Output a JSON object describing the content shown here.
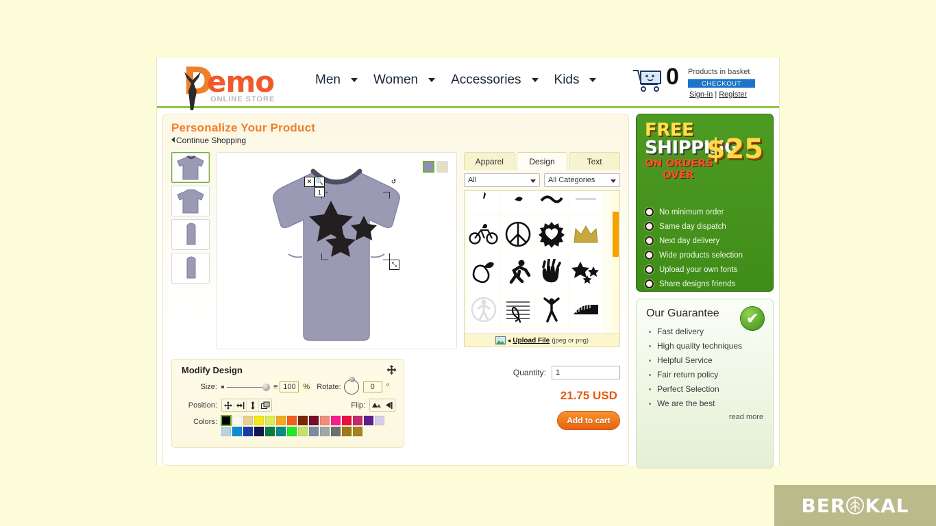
{
  "header": {
    "logo_main": "emo",
    "logo_d": "D",
    "logo_sub": "ONLINE STORE",
    "nav": [
      {
        "label": "Men"
      },
      {
        "label": "Women"
      },
      {
        "label": "Accessories"
      },
      {
        "label": "Kids"
      }
    ],
    "cart": {
      "count": "0",
      "text": "Products in basket",
      "checkout_label": "CHECKOUT",
      "signin": "Sign-in",
      "separator": "|",
      "register": "Register"
    }
  },
  "main": {
    "page_title": "Personalize Your Product",
    "continue_shopping": "Continue Shopping"
  },
  "stage": {
    "thumbnails": [
      {
        "name": "front-view"
      },
      {
        "name": "back-view"
      },
      {
        "name": "left-view"
      },
      {
        "name": "right-view"
      }
    ],
    "apparel_colors": [
      {
        "hex": "#8f8fbe",
        "selected": true
      },
      {
        "hex": "#e8ddc0",
        "selected": false
      }
    ],
    "design_layer_number": "1",
    "shirt_color": "#9a9ab4"
  },
  "tools": {
    "tabs": [
      {
        "label": "Apparel",
        "active": false
      },
      {
        "label": "Design",
        "active": true
      },
      {
        "label": "Text",
        "active": false
      }
    ],
    "filter_type": "All",
    "filter_category": "All Categories",
    "icons": [
      {
        "name": "partial-icon-1"
      },
      {
        "name": "partial-icon-2"
      },
      {
        "name": "partial-icon-3"
      },
      {
        "name": "partial-icon-4"
      },
      {
        "name": "bicycle-icon"
      },
      {
        "name": "peace-sign-icon"
      },
      {
        "name": "heart-burst-icon"
      },
      {
        "name": "crown-icon"
      },
      {
        "name": "apple-icon"
      },
      {
        "name": "runner-icon"
      },
      {
        "name": "handprint-icon"
      },
      {
        "name": "stars-icon"
      },
      {
        "name": "figure-circle-icon"
      },
      {
        "name": "music-staff-icon"
      },
      {
        "name": "dancer-icon"
      },
      {
        "name": "piano-icon"
      },
      {
        "name": "partial-icon-5"
      },
      {
        "name": "partial-icon-6"
      },
      {
        "name": "partial-icon-7"
      },
      {
        "name": "partial-icon-8"
      }
    ],
    "upload_label": "Upload File",
    "upload_note": "(jpeg or png)"
  },
  "modify": {
    "title": "Modify Design",
    "size_label": "Size:",
    "size_value": "100",
    "size_unit": "%",
    "rotate_label": "Rotate:",
    "rotate_value": "0",
    "rotate_unit": "°",
    "position_label": "Position:",
    "flip_label": "Flip:",
    "colors_label": "Colors:",
    "position_buttons": [
      {
        "name": "center-both-button"
      },
      {
        "name": "center-horizontal-button"
      },
      {
        "name": "center-vertical-button"
      },
      {
        "name": "bring-to-front-button"
      }
    ],
    "flip_buttons": [
      {
        "name": "flip-vertical-button"
      },
      {
        "name": "flip-horizontal-button"
      }
    ],
    "palette": [
      {
        "hex": "#000000",
        "selected": true
      },
      {
        "hex": "#fdfbf0",
        "selected": false
      },
      {
        "hex": "#e8cf92",
        "selected": false
      },
      {
        "hex": "#f7e619",
        "selected": false
      },
      {
        "hex": "#ddea5a",
        "selected": false
      },
      {
        "hex": "#f5a91f",
        "selected": false
      },
      {
        "hex": "#f0601c",
        "selected": false
      },
      {
        "hex": "#772a06",
        "selected": false
      },
      {
        "hex": "#7a0d2a",
        "selected": false
      },
      {
        "hex": "#f28b7d",
        "selected": false
      },
      {
        "hex": "#f51e8c",
        "selected": false
      },
      {
        "hex": "#e8103f",
        "selected": false
      },
      {
        "hex": "#c62a6e",
        "selected": false
      },
      {
        "hex": "#5d1e92",
        "selected": false
      },
      {
        "hex": "#d6cbe9",
        "selected": false
      },
      {
        "hex": "#b9d3e6",
        "selected": false
      },
      {
        "hex": "#0a8ed4",
        "selected": false
      },
      {
        "hex": "#1c39a8",
        "selected": false
      },
      {
        "hex": "#12174d",
        "selected": false
      },
      {
        "hex": "#0c7a43",
        "selected": false
      },
      {
        "hex": "#098a83",
        "selected": false
      },
      {
        "hex": "#21e825",
        "selected": false
      },
      {
        "hex": "#c5e16a",
        "selected": false
      },
      {
        "hex": "#7b8da0",
        "selected": false
      },
      {
        "hex": "#9ea9a5",
        "selected": false
      },
      {
        "hex": "#6f6f6f",
        "selected": false
      },
      {
        "hex": "#9c7a14",
        "selected": false
      },
      {
        "hex": "#a58320",
        "selected": false
      }
    ]
  },
  "buy": {
    "quantity_label": "Quantity:",
    "quantity_value": "1",
    "price": "21.75 USD",
    "add_to_cart": "Add to cart"
  },
  "promo": {
    "line1_a": "FREE",
    "line1_b": "SHIPPING",
    "line2_a": "ON ORDERS",
    "line2_b": "OVER",
    "amount": "$25",
    "features": [
      "No minimum order",
      "Same day dispatch",
      "Next day delivery",
      "Wide products selection",
      "Upload your own fonts",
      "Share designs friends"
    ]
  },
  "guarantee": {
    "title": "Our Guarantee",
    "items": [
      "Fast delivery",
      "High quality techniques",
      "Helpful Service",
      "Fair return policy",
      "Perfect Selection",
      "We are the best"
    ],
    "read_more": "read more"
  },
  "watermark": {
    "text_a": "BER",
    "text_b": "KAL"
  }
}
